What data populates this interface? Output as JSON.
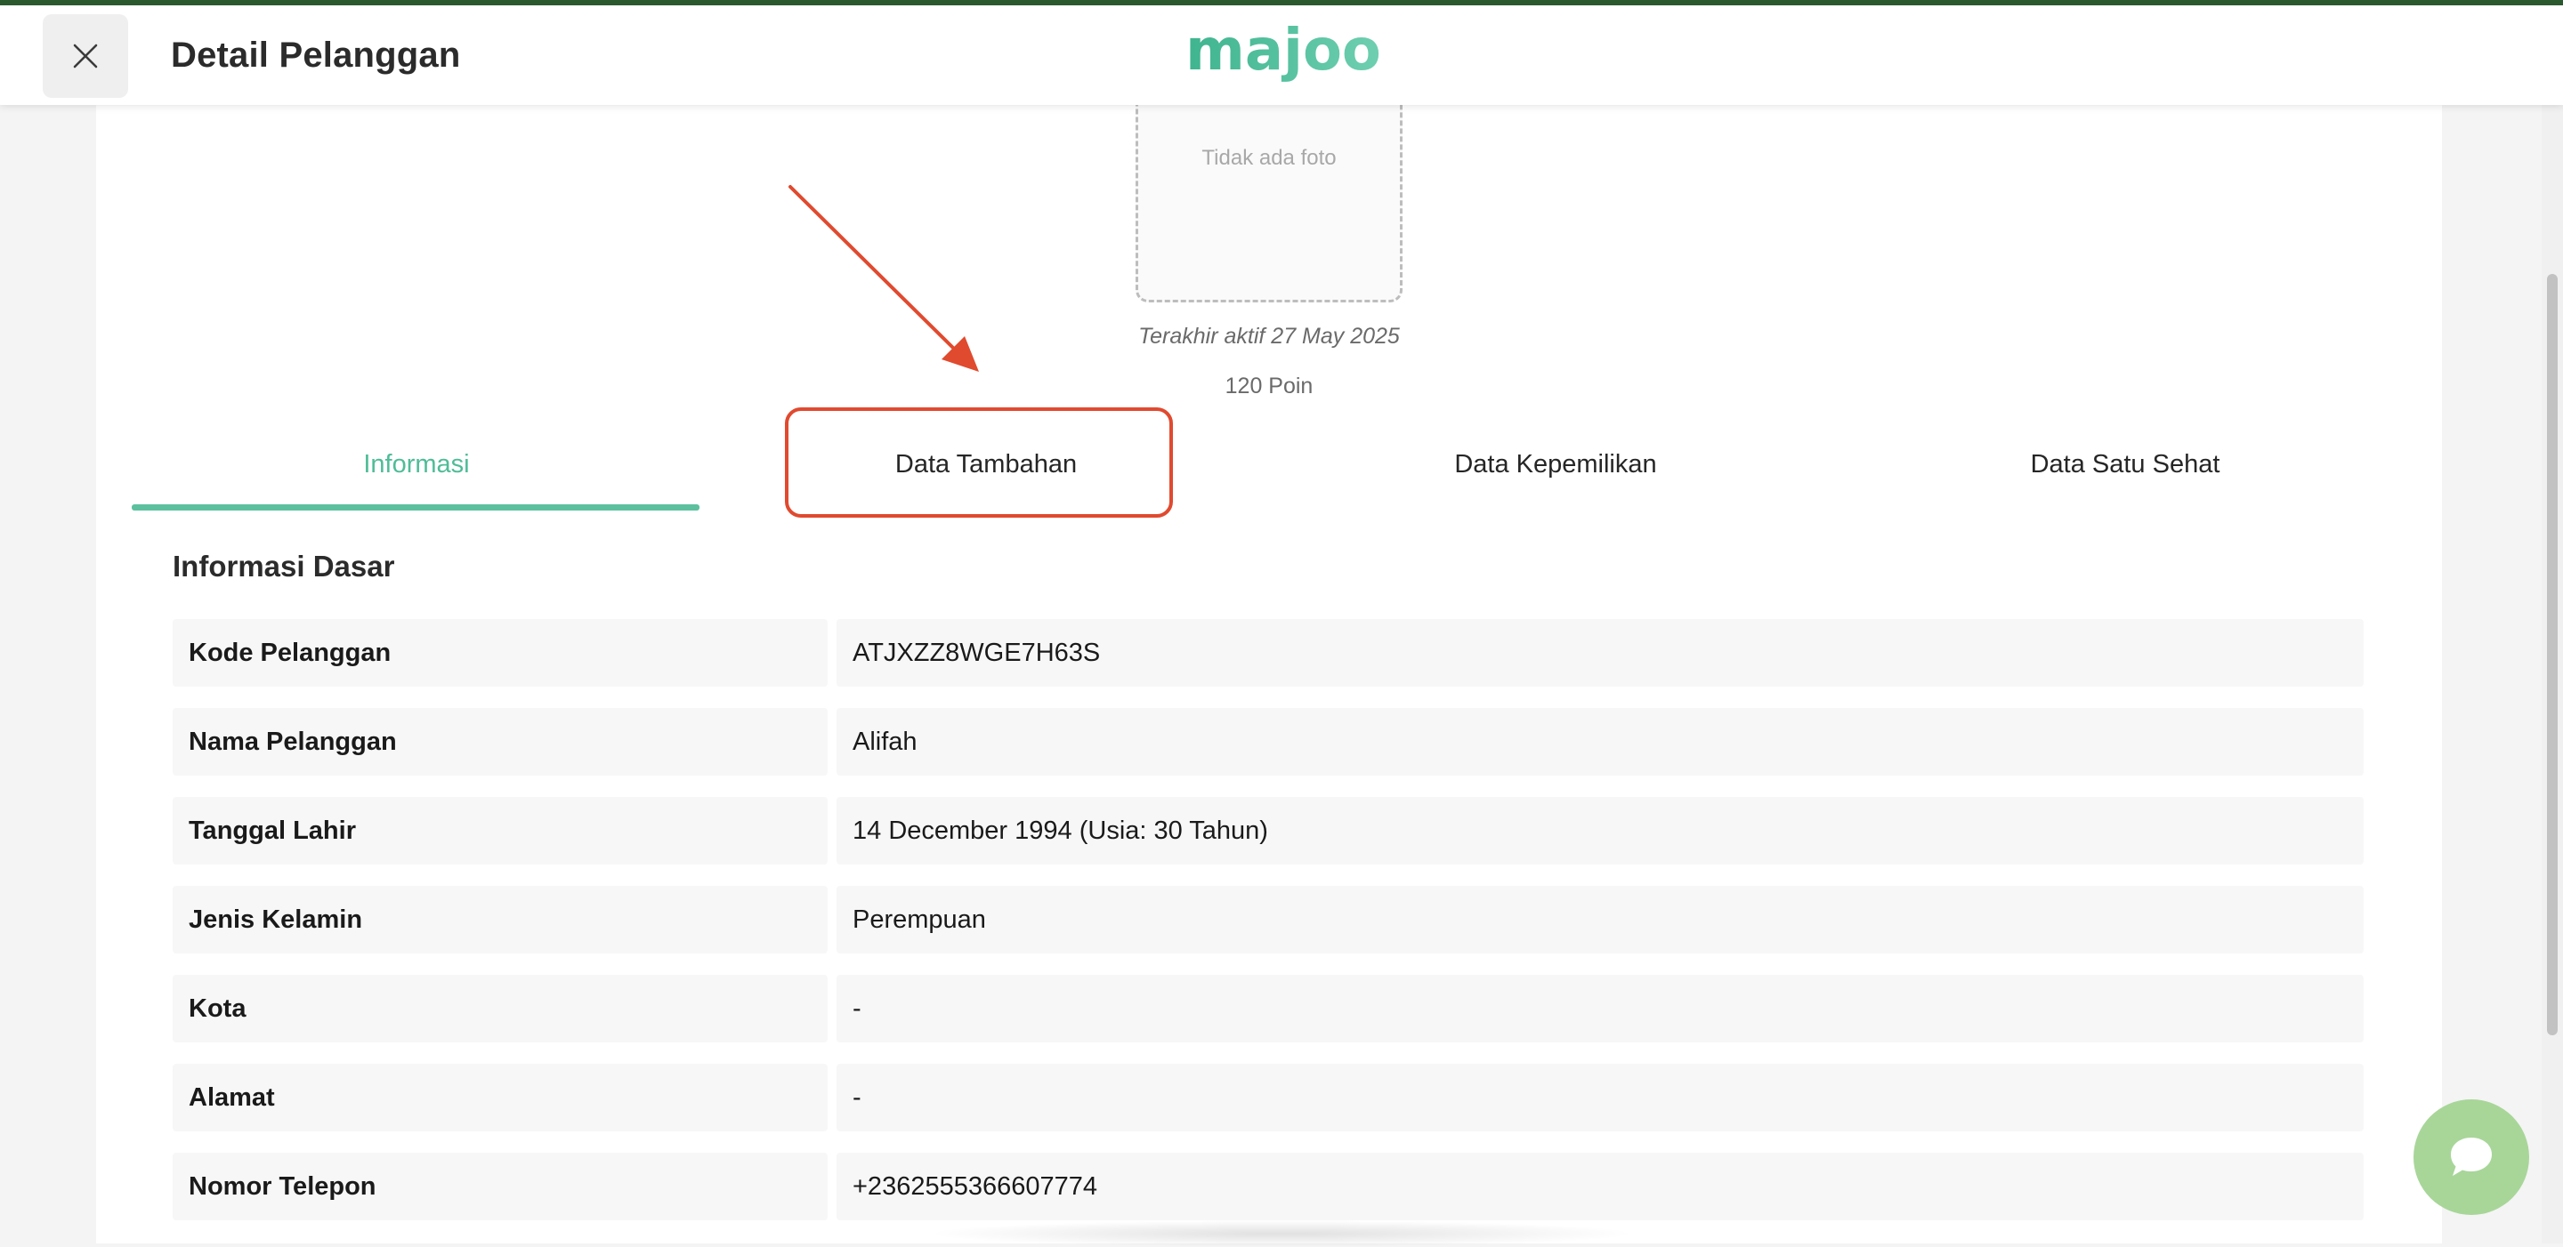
{
  "header": {
    "title": "Detail Pelanggan",
    "logo_text": "majoo"
  },
  "profile": {
    "photo_placeholder": "Tidak ada foto",
    "last_active": "Terakhir aktif 27 May 2025",
    "points": "120 Poin"
  },
  "tabs": [
    {
      "label": "Informasi",
      "active": true
    },
    {
      "label": "Data Tambahan",
      "active": false
    },
    {
      "label": "Data Kepemilikan",
      "active": false
    },
    {
      "label": "Data Satu Sehat",
      "active": false
    }
  ],
  "section": {
    "title": "Informasi Dasar"
  },
  "rows": [
    {
      "label": "Kode Pelanggan",
      "value": "ATJXZZ8WGE7H63S"
    },
    {
      "label": "Nama Pelanggan",
      "value": "Alifah"
    },
    {
      "label": "Tanggal Lahir",
      "value": "14 December 1994 (Usia: 30 Tahun)"
    },
    {
      "label": "Jenis Kelamin",
      "value": "Perempuan"
    },
    {
      "label": "Kota",
      "value": "-"
    },
    {
      "label": "Alamat",
      "value": "-"
    },
    {
      "label": "Nomor Telepon",
      "value": "+2362555366607774"
    }
  ],
  "colors": {
    "accent": "#5cc09e",
    "highlight": "#e04a2f",
    "chat": "#a8d699"
  },
  "icons": {
    "close": "close-icon",
    "chat": "chat-bubble-icon"
  }
}
